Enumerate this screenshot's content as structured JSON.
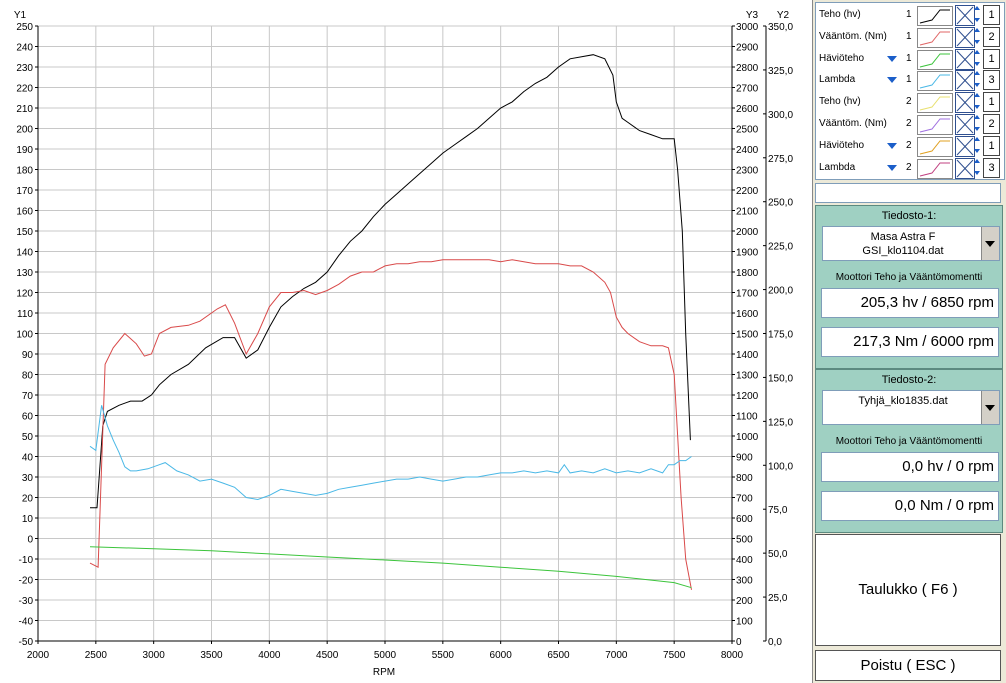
{
  "chart_data": {
    "type": "line",
    "xlabel": "RPM",
    "xlim": [
      2000,
      8000
    ],
    "x_ticks": [
      2000,
      2500,
      3000,
      3500,
      4000,
      4500,
      5000,
      5500,
      6000,
      6500,
      7000,
      7500,
      8000
    ],
    "y1_label": "Y1",
    "y1_lim": [
      -50,
      250
    ],
    "y1_ticks": [
      250,
      240,
      230,
      220,
      210,
      200,
      190,
      180,
      170,
      160,
      150,
      140,
      130,
      120,
      110,
      100,
      90,
      80,
      70,
      60,
      50,
      40,
      30,
      20,
      10,
      0,
      -10,
      -20,
      -30,
      -40,
      -50
    ],
    "y3_label": "Y3",
    "y3_lim": [
      0,
      3000
    ],
    "y3_ticks": [
      3000,
      2900,
      2800,
      2700,
      2600,
      2500,
      2400,
      2300,
      2200,
      2100,
      2000,
      1900,
      1800,
      1700,
      1600,
      1500,
      1400,
      1300,
      1200,
      1100,
      1000,
      900,
      800,
      700,
      600,
      500,
      400,
      300,
      200,
      100,
      0
    ],
    "y2_label": "Y2",
    "y2_lim": [
      0,
      350
    ],
    "y2_ticks": [
      "350,0",
      "325,0",
      "300,0",
      "275,0",
      "250,0",
      "225,0",
      "200,0",
      "175,0",
      "150,0",
      "125,0",
      "100,0",
      "75,0",
      "50,0",
      "25,0",
      "0,0"
    ],
    "grid": true,
    "series": [
      {
        "name": "Teho (hv)",
        "color": "#000000",
        "axis": "Y1",
        "x": [
          2450,
          2510,
          2560,
          2600,
          2700,
          2800,
          2900,
          2980,
          3050,
          3150,
          3300,
          3450,
          3600,
          3700,
          3800,
          3900,
          4000,
          4100,
          4200,
          4300,
          4400,
          4500,
          4600,
          4700,
          4800,
          4900,
          5000,
          5100,
          5200,
          5300,
          5400,
          5500,
          5600,
          5700,
          5800,
          5900,
          6000,
          6100,
          6200,
          6300,
          6400,
          6500,
          6600,
          6700,
          6800,
          6900,
          6970,
          7000,
          7050,
          7100,
          7200,
          7300,
          7400,
          7500,
          7530,
          7570,
          7600,
          7640
        ],
        "y": [
          15,
          15,
          55,
          62,
          65,
          67,
          67,
          70,
          75,
          80,
          85,
          93,
          98,
          98,
          88,
          92,
          103,
          113,
          118,
          122,
          125,
          130,
          138,
          145,
          150,
          157,
          163,
          168,
          173,
          178,
          183,
          188,
          192,
          196,
          200,
          205,
          210,
          213,
          218,
          222,
          225,
          230,
          234,
          235,
          236,
          234,
          226,
          213,
          205,
          203,
          199,
          197,
          195,
          195,
          180,
          150,
          100,
          48
        ]
      },
      {
        "name": "Vääntöm. (Nm)",
        "color": "#d94a4a",
        "axis": "Y1",
        "x": [
          2450,
          2520,
          2580,
          2650,
          2750,
          2850,
          2920,
          2980,
          3050,
          3150,
          3300,
          3400,
          3550,
          3620,
          3700,
          3800,
          3900,
          4000,
          4100,
          4200,
          4300,
          4400,
          4500,
          4600,
          4700,
          4800,
          4900,
          5000,
          5100,
          5200,
          5300,
          5400,
          5500,
          5600,
          5700,
          5800,
          5900,
          6000,
          6100,
          6200,
          6300,
          6400,
          6500,
          6600,
          6700,
          6800,
          6900,
          6950,
          7000,
          7050,
          7100,
          7200,
          7300,
          7400,
          7450,
          7500,
          7560,
          7600,
          7650
        ],
        "y": [
          -12,
          -14,
          85,
          93,
          100,
          95,
          89,
          90,
          100,
          103,
          104,
          106,
          112,
          114,
          105,
          90,
          100,
          113,
          120,
          120,
          121,
          119,
          121,
          124,
          128,
          130,
          130,
          133,
          134,
          134,
          135,
          135,
          136,
          136,
          136,
          136,
          136,
          135,
          136,
          135,
          134,
          134,
          134,
          133,
          133,
          130,
          125,
          120,
          108,
          103,
          100,
          96,
          94,
          94,
          93,
          80,
          20,
          -10,
          -25
        ]
      },
      {
        "name": "Häviöteho",
        "color": "#3cc43c",
        "axis": "Y1",
        "x": [
          2450,
          3000,
          3500,
          4000,
          4500,
          5000,
          5500,
          6000,
          6500,
          7000,
          7500,
          7650
        ],
        "y": [
          -4,
          -5,
          -6,
          -7.5,
          -9,
          -10.5,
          -12,
          -14,
          -16,
          -18.5,
          -21.5,
          -24
        ]
      },
      {
        "name": "Lambda",
        "color": "#4ab8e6",
        "axis": "Y1",
        "x": [
          2450,
          2500,
          2550,
          2600,
          2650,
          2700,
          2750,
          2800,
          2850,
          2950,
          3050,
          3100,
          3200,
          3300,
          3400,
          3500,
          3600,
          3700,
          3800,
          3900,
          4000,
          4100,
          4200,
          4300,
          4400,
          4500,
          4600,
          4700,
          4800,
          4900,
          5000,
          5100,
          5200,
          5300,
          5400,
          5500,
          5600,
          5700,
          5800,
          5900,
          6000,
          6100,
          6200,
          6300,
          6400,
          6500,
          6550,
          6600,
          6700,
          6800,
          6900,
          7000,
          7100,
          7200,
          7300,
          7400,
          7450,
          7500,
          7550,
          7600,
          7650
        ],
        "y": [
          45,
          43,
          65,
          55,
          48,
          42,
          35,
          33,
          33,
          34,
          36,
          37,
          33,
          31,
          28,
          29,
          27,
          25,
          20,
          19,
          21,
          24,
          23,
          22,
          21,
          22,
          24,
          25,
          26,
          27,
          28,
          29,
          29,
          30,
          29,
          28,
          29,
          30,
          30,
          31,
          32,
          32,
          33,
          32,
          33,
          32,
          36,
          32,
          33,
          32,
          34,
          32,
          33,
          32,
          34,
          32,
          36,
          36,
          38,
          38,
          40
        ]
      }
    ]
  },
  "legend": [
    {
      "label": "Teho (hv)",
      "arrow": false,
      "num": "1",
      "color": "#000000",
      "axis": "1"
    },
    {
      "label": "Vääntöm. (Nm)",
      "arrow": false,
      "num": "1",
      "color": "#e06666",
      "axis": "2"
    },
    {
      "label": "Häviöteho",
      "arrow": true,
      "num": "1",
      "color": "#3cc43c",
      "axis": "1"
    },
    {
      "label": "Lambda",
      "arrow": true,
      "num": "1",
      "color": "#4ab8e6",
      "axis": "3"
    },
    {
      "label": "Teho (hv)",
      "arrow": false,
      "num": "2",
      "color": "#e8e070",
      "axis": "1"
    },
    {
      "label": "Vääntöm. (Nm)",
      "arrow": false,
      "num": "2",
      "color": "#a070e0",
      "axis": "2"
    },
    {
      "label": "Häviöteho",
      "arrow": true,
      "num": "2",
      "color": "#e0a020",
      "axis": "1"
    },
    {
      "label": "Lambda",
      "arrow": true,
      "num": "2",
      "color": "#c04080",
      "axis": "3"
    }
  ],
  "file1": {
    "title": "Tiedosto-1:",
    "name_line1": "Masa Astra F",
    "name_line2": "GSI_klo1104.dat",
    "subtitle": "Moottori Teho ja Vääntömomentti",
    "power": "205,3 hv / 6850 rpm",
    "torque": "217,3 Nm / 6000 rpm"
  },
  "file2": {
    "title": "Tiedosto-2:",
    "name_line1": "Tyhjä_klo1835.dat",
    "subtitle": "Moottori Teho ja Vääntömomentti",
    "power": "0,0 hv / 0 rpm",
    "torque": "0,0 Nm / 0 rpm"
  },
  "buttons": {
    "table": "Taulukko ( F6 )",
    "exit": "Poistu ( ESC )"
  }
}
